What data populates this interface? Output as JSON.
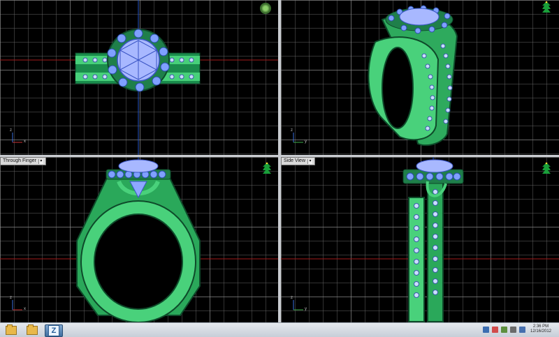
{
  "app": {
    "viewports": {
      "top_left": {
        "label": "",
        "axes": {
          "x": "x",
          "z": "z"
        }
      },
      "top_right": {
        "label": "",
        "axes": {
          "y": "y",
          "z": "z"
        }
      },
      "bottom_left": {
        "label": "Through Finger",
        "axes": {
          "x": "x",
          "z": "z"
        }
      },
      "bottom_right": {
        "label": "Side View",
        "axes": {
          "y": "y",
          "z": "z"
        }
      }
    }
  },
  "taskbar": {
    "clock": {
      "time": "2:36 PM",
      "date": "12/16/2012"
    },
    "apps": [
      "folder-icon",
      "folder-icon",
      "z-icon"
    ]
  },
  "colors": {
    "ring_green": "#3fbf6a",
    "ring_dark": "#136b38",
    "gem_blue": "#8ea8ff",
    "grid": "#666666",
    "axis_red": "#a51c1c",
    "axis_blue": "#2957c8"
  }
}
